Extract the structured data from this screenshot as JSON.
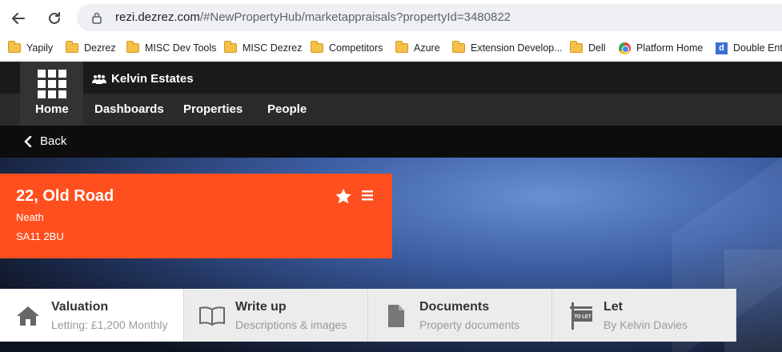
{
  "browser": {
    "url_host": "rezi.dezrez.com",
    "url_path": "/#NewPropertyHub/marketappraisals?propertyId=3480822",
    "bookmarks": [
      {
        "label": "Yapily",
        "icon": "folder-icon"
      },
      {
        "label": "Dezrez",
        "icon": "folder-icon"
      },
      {
        "label": "MISC Dev Tools",
        "icon": "folder-icon"
      },
      {
        "label": "MISC Dezrez",
        "icon": "folder-icon"
      },
      {
        "label": "Competitors",
        "icon": "folder-icon"
      },
      {
        "label": "Azure",
        "icon": "folder-icon"
      },
      {
        "label": "Extension Develop...",
        "icon": "folder-icon"
      },
      {
        "label": "Dell",
        "icon": "folder-icon"
      },
      {
        "label": "Platform Home",
        "icon": "platform-icon"
      },
      {
        "label": "Double Entr",
        "icon": "d-icon",
        "badge": "d"
      }
    ]
  },
  "app": {
    "brand": "Kelvin Estates",
    "nav": {
      "home": "Home",
      "dashboards": "Dashboards",
      "properties": "Properties",
      "people": "People"
    },
    "back": "Back"
  },
  "property": {
    "title": "22, Old Road",
    "town": "Neath",
    "postcode": "SA11 2BU",
    "accent": "#ff4f1f"
  },
  "tabs": [
    {
      "title": "Valuation",
      "subtitle": "Letting: £1,200 Monthly",
      "icon": "house-icon"
    },
    {
      "title": "Write up",
      "subtitle": "Descriptions & images",
      "icon": "book-icon"
    },
    {
      "title": "Documents",
      "subtitle": "Property documents",
      "icon": "document-icon"
    },
    {
      "title": "Let",
      "subtitle": "By Kelvin Davies",
      "icon": "to-let-sign-icon",
      "sign_text": "TO LET"
    }
  ]
}
